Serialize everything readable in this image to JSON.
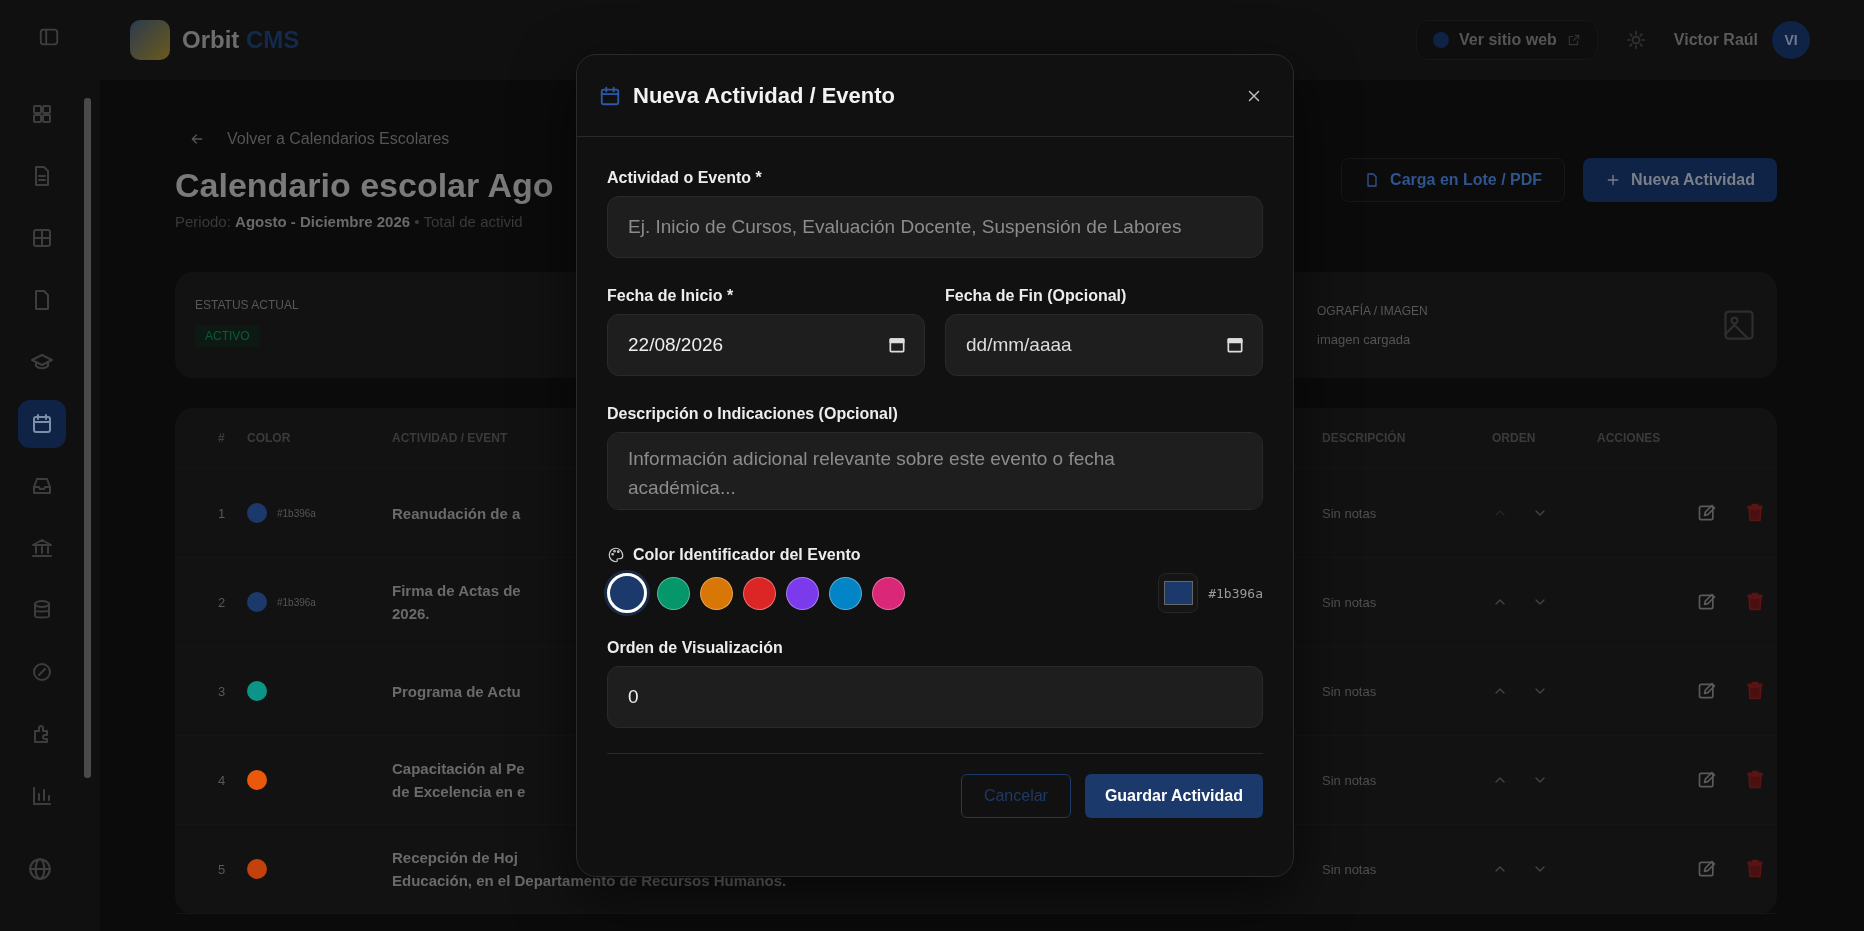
{
  "topbar": {
    "brand": "Orbit",
    "brand_accent": "CMS",
    "site_link": "Ver sitio web",
    "user_name": "Victor Raúl",
    "avatar_initials": "VI"
  },
  "sidebar": {
    "items": [
      {
        "selected": false
      },
      {
        "selected": false
      },
      {
        "selected": false
      },
      {
        "selected": false
      },
      {
        "selected": false
      },
      {
        "selected": true
      },
      {
        "selected": false
      },
      {
        "selected": false
      },
      {
        "selected": false
      },
      {
        "selected": false
      },
      {
        "selected": false
      },
      {
        "selected": false
      }
    ]
  },
  "page": {
    "back_link": "Volver a Calendarios Escolares",
    "title": "Calendario escolar Ago",
    "subtitle": "Periodo: **Agosto - Diciembre 2026** • Total de activid",
    "buttons": [
      {
        "label": "Carga en Lote / PDF",
        "kind": "outline"
      },
      {
        "label": "Nueva Actividad",
        "kind": "primary"
      }
    ],
    "status": {
      "label": "ESTATUS ACTUAL",
      "badge": "ACTIVO",
      "image_label": "OGRAFÍA / IMAGEN",
      "image_note": "imagen cargada"
    },
    "table": {
      "columns": [
        "#",
        "COLOR",
        "ACTIVIDAD / EVENT",
        "DESCRIPCIÓN",
        "ORDEN",
        "ACCIONES"
      ],
      "rows": [
        {
          "num": "1",
          "color": "#1b396a",
          "hex": "#1b396a",
          "activity": [
            "Reanudación de a"
          ],
          "description": "Sin notas",
          "up_disabled": true
        },
        {
          "num": "2",
          "color": "#1b396a",
          "hex": "#1b396a",
          "activity": [
            "Firma de Actas de",
            "2026."
          ],
          "description": "Sin notas",
          "up_disabled": false
        },
        {
          "num": "3",
          "color": "#0d9488",
          "activity": [
            "Programa de Actu"
          ],
          "description": "Sin notas",
          "up_disabled": false
        },
        {
          "num": "4",
          "color": "#ea580c",
          "activity": [
            "Capacitación al Pe",
            "de Excelencia en e"
          ],
          "description": "Sin notas",
          "up_disabled": false
        },
        {
          "num": "5",
          "color": "#c2410c",
          "activity": [
            "Recepción de Hoj",
            "Educación, en el Departamento de Recursos Humanos."
          ],
          "description": "Sin notas",
          "up_disabled": false
        }
      ]
    }
  },
  "modal": {
    "title": "Nueva Actividad / Evento",
    "activity": {
      "label": "Actividad o Evento *",
      "placeholder": "Ej. Inicio de Cursos, Evaluación Docente, Suspensión de Labores"
    },
    "dates": [
      {
        "label": "Fecha de Inicio *",
        "value": "22/08/2026"
      },
      {
        "label": "Fecha de Fin (Opcional)",
        "placeholder": "dd/mm/aaaa"
      }
    ],
    "description": {
      "label": "Descripción o Indicaciones (Opcional)",
      "placeholder": "Información adicional relevante sobre este evento o fecha académica..."
    },
    "color": {
      "label": "Color Identificador del Evento",
      "hex": "#1b396a",
      "swatches": [
        {
          "color": "#1b396a",
          "selected": true
        },
        {
          "color": "#059669",
          "selected": false
        },
        {
          "color": "#d97706",
          "selected": false
        },
        {
          "color": "#dc2626",
          "selected": false
        },
        {
          "color": "#7c3aed",
          "selected": false
        },
        {
          "color": "#0284c7",
          "selected": false
        },
        {
          "color": "#db2777",
          "selected": false
        }
      ]
    },
    "order": {
      "label": "Orden de Visualización",
      "value": "0"
    },
    "buttons": [
      {
        "label": "Cancelar",
        "kind": "outline"
      },
      {
        "label": "Guardar Actividad",
        "kind": "primary"
      }
    ]
  }
}
